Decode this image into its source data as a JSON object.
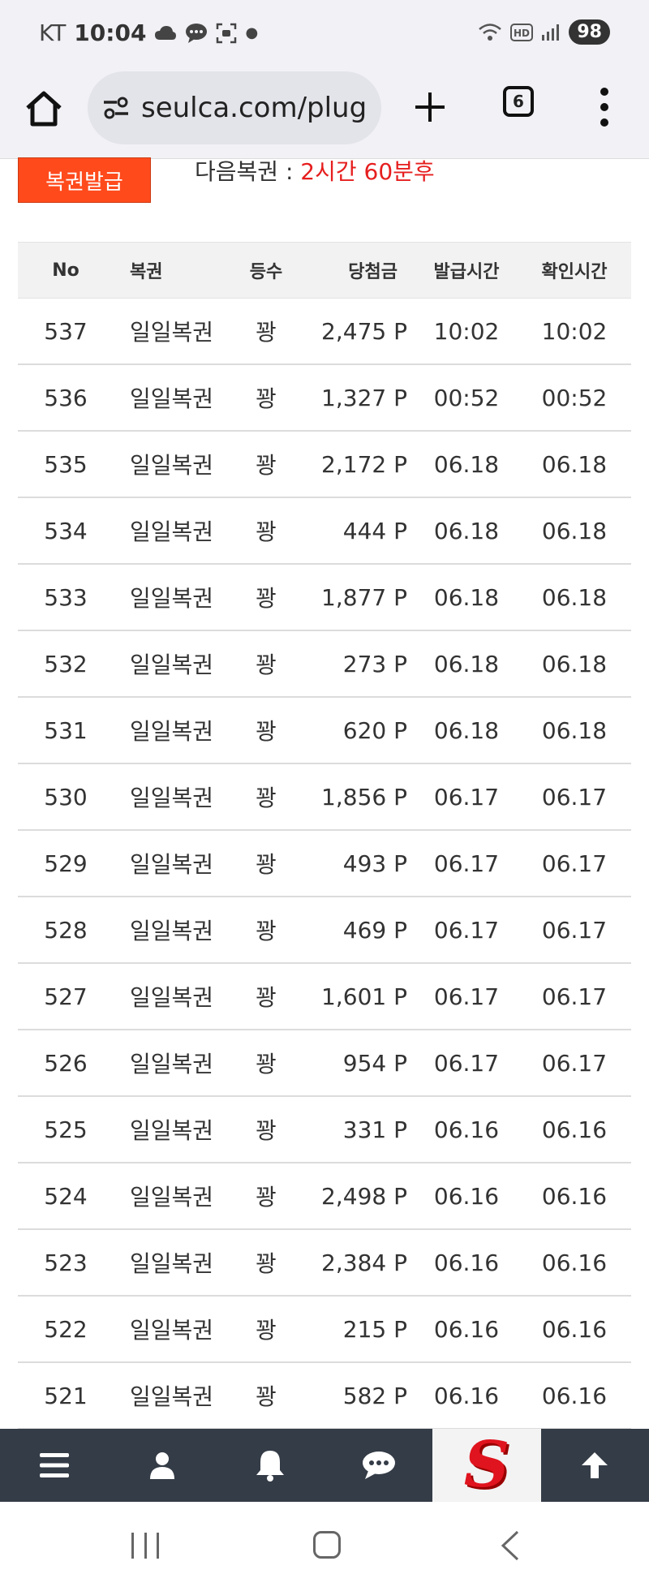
{
  "status_bar": {
    "carrier": "KT",
    "time": "10:04",
    "battery": "98"
  },
  "browser": {
    "url": "seulca.com/plug",
    "tab_count": "6"
  },
  "top": {
    "issue_button_label": "복권발급",
    "next_label": "다음복권 : ",
    "next_value": "2시간 60분후"
  },
  "table": {
    "headers": [
      "No",
      "복권",
      "등수",
      "당첨금",
      "발급시간",
      "확인시간"
    ],
    "rows": [
      {
        "no": "537",
        "name": "일일복권",
        "rank": "꽝",
        "amount": "2,475 P",
        "issued": "10:02",
        "checked": "10:02"
      },
      {
        "no": "536",
        "name": "일일복권",
        "rank": "꽝",
        "amount": "1,327 P",
        "issued": "00:52",
        "checked": "00:52"
      },
      {
        "no": "535",
        "name": "일일복권",
        "rank": "꽝",
        "amount": "2,172 P",
        "issued": "06.18",
        "checked": "06.18"
      },
      {
        "no": "534",
        "name": "일일복권",
        "rank": "꽝",
        "amount": "444 P",
        "issued": "06.18",
        "checked": "06.18"
      },
      {
        "no": "533",
        "name": "일일복권",
        "rank": "꽝",
        "amount": "1,877 P",
        "issued": "06.18",
        "checked": "06.18"
      },
      {
        "no": "532",
        "name": "일일복권",
        "rank": "꽝",
        "amount": "273 P",
        "issued": "06.18",
        "checked": "06.18"
      },
      {
        "no": "531",
        "name": "일일복권",
        "rank": "꽝",
        "amount": "620 P",
        "issued": "06.18",
        "checked": "06.18"
      },
      {
        "no": "530",
        "name": "일일복권",
        "rank": "꽝",
        "amount": "1,856 P",
        "issued": "06.17",
        "checked": "06.17"
      },
      {
        "no": "529",
        "name": "일일복권",
        "rank": "꽝",
        "amount": "493 P",
        "issued": "06.17",
        "checked": "06.17"
      },
      {
        "no": "528",
        "name": "일일복권",
        "rank": "꽝",
        "amount": "469 P",
        "issued": "06.17",
        "checked": "06.17"
      },
      {
        "no": "527",
        "name": "일일복권",
        "rank": "꽝",
        "amount": "1,601 P",
        "issued": "06.17",
        "checked": "06.17"
      },
      {
        "no": "526",
        "name": "일일복권",
        "rank": "꽝",
        "amount": "954 P",
        "issued": "06.17",
        "checked": "06.17"
      },
      {
        "no": "525",
        "name": "일일복권",
        "rank": "꽝",
        "amount": "331 P",
        "issued": "06.16",
        "checked": "06.16"
      },
      {
        "no": "524",
        "name": "일일복권",
        "rank": "꽝",
        "amount": "2,498 P",
        "issued": "06.16",
        "checked": "06.16"
      },
      {
        "no": "523",
        "name": "일일복권",
        "rank": "꽝",
        "amount": "2,384 P",
        "issued": "06.16",
        "checked": "06.16"
      },
      {
        "no": "522",
        "name": "일일복권",
        "rank": "꽝",
        "amount": "215 P",
        "issued": "06.16",
        "checked": "06.16"
      },
      {
        "no": "521",
        "name": "일일복권",
        "rank": "꽝",
        "amount": "582 P",
        "issued": "06.16",
        "checked": "06.16"
      }
    ]
  },
  "app_nav": {
    "logo_text": "S",
    "icons": [
      "menu-icon",
      "user-icon",
      "bell-icon",
      "chat-icon",
      "site-logo",
      "arrow-up-icon"
    ]
  },
  "colors": {
    "accent_orange": "#ff4a1c",
    "highlight_red": "#e61e1e",
    "nav_bg": "#343c47"
  }
}
